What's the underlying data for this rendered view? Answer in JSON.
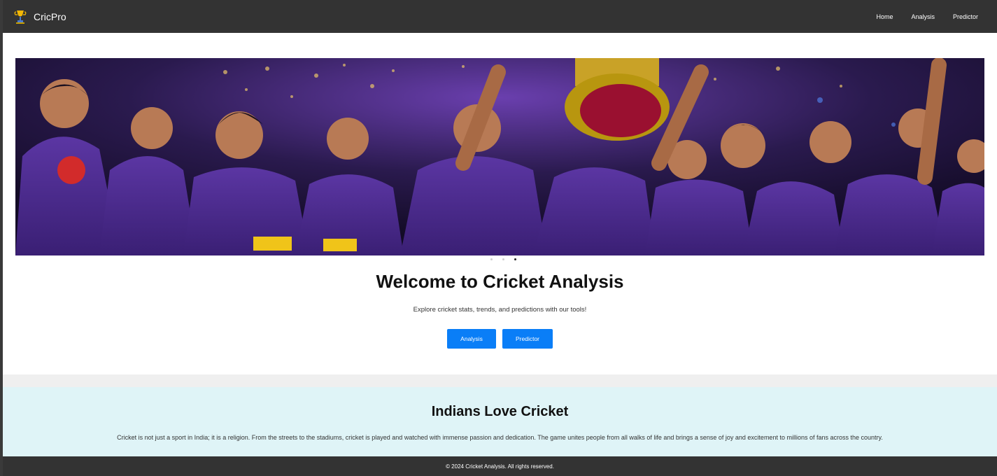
{
  "navbar": {
    "brand": "CricPro",
    "links": [
      "Home",
      "Analysis",
      "Predictor"
    ]
  },
  "hero": {
    "title": "Welcome to Cricket Analysis",
    "subtitle": "Explore cricket stats, trends, and predictions with our tools!",
    "buttons": [
      "Analysis",
      "Predictor"
    ],
    "carousel_slides": 3,
    "active_slide": 3
  },
  "info": {
    "title": "Indians Love Cricket",
    "text": "Cricket is not just a sport in India; it is a religion. From the streets to the stadiums, cricket is played and watched with immense passion and dedication. The game unites people from all walks of life and brings a sense of joy and excitement to millions of fans across the country."
  },
  "footer": {
    "text": "© 2024 Cricket Analysis. All rights reserved."
  },
  "colors": {
    "navbar": "#333333",
    "button": "#0a7ef7",
    "info_bg": "#dff4f7",
    "jersey": "#4b2a8a"
  },
  "icons": {
    "brand": "trophy-logo-icon"
  }
}
